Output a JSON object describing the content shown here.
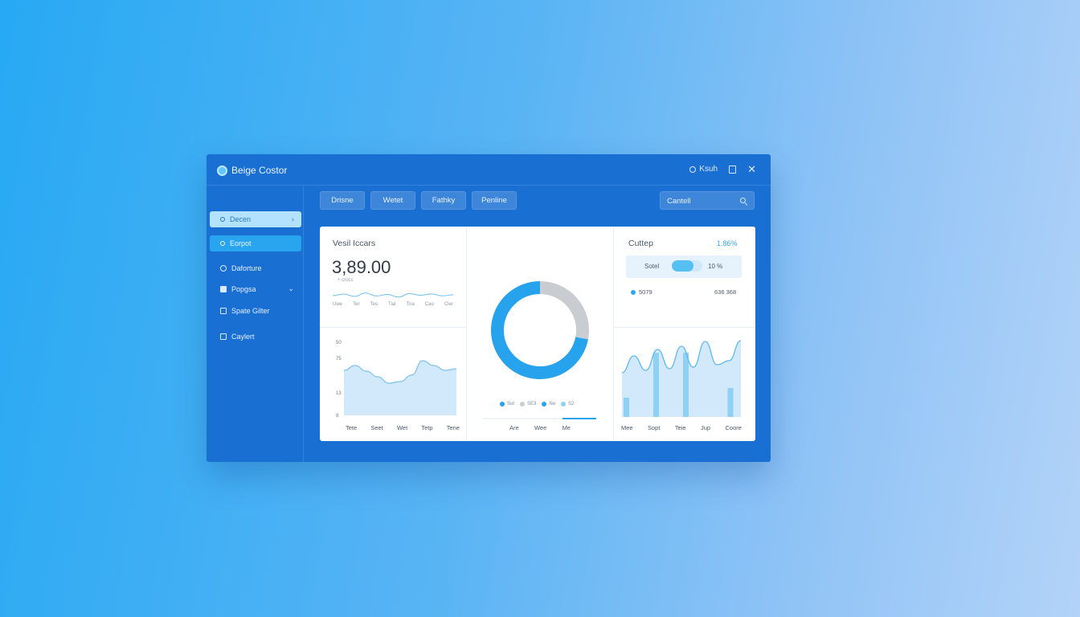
{
  "app": {
    "title": "Beige Costor"
  },
  "titlebar": {
    "action_label": "Ksuh"
  },
  "sidebar": {
    "items": [
      {
        "label": "Decen"
      },
      {
        "label": "Eorpot"
      },
      {
        "label": "Daforture"
      },
      {
        "label": "Popgsa"
      },
      {
        "label": "Spate Gilter"
      },
      {
        "label": "Caylert"
      }
    ]
  },
  "toolbar": {
    "buttons": [
      "Drisne",
      "Wetet",
      "Fathky",
      "Penline"
    ]
  },
  "search": {
    "value": "Cantell"
  },
  "stat": {
    "label": "Vesil Iccars",
    "value": "3,89.00",
    "sub": "+ crocs"
  },
  "sparkline": {
    "ticks": [
      "Uwe",
      "Ter",
      "Tes",
      "Tial",
      "Tira",
      "Cao",
      "Cier"
    ],
    "values": [
      0.42,
      0.5,
      0.38,
      0.55,
      0.4,
      0.48,
      0.34,
      0.52,
      0.44,
      0.5,
      0.41,
      0.46
    ]
  },
  "cup": {
    "title": "Cuttep",
    "pct": "1.86%"
  },
  "progress": {
    "label": "Sotel",
    "pct": "10 %",
    "value": 0.72
  },
  "row": {
    "label": "5079",
    "value": "636 368"
  },
  "colors": {
    "primary": "#27a2ec",
    "light": "#8fd0f5",
    "gray": "#c9cdd2",
    "area": "#d2e9fb"
  },
  "chart_data": [
    {
      "type": "area",
      "ytick_labels": [
        "50",
        "75",
        "13",
        "8"
      ],
      "categories": [
        "Tete",
        "Seet",
        "Wet",
        "Tetp",
        "Tene"
      ],
      "ylim": [
        0,
        100
      ],
      "values": [
        56,
        62,
        55,
        48,
        40,
        42,
        50,
        68,
        62,
        56,
        58
      ]
    },
    {
      "type": "pie",
      "donut": true,
      "values": [
        72,
        28
      ],
      "legend": [
        "Sut",
        "SE3",
        "Ne",
        "S2"
      ],
      "categories": [
        "Are",
        "Wee",
        "Me"
      ]
    },
    {
      "type": "area",
      "categories": [
        "Mee",
        "Sopt",
        "Teie",
        "Jup",
        "Coore"
      ],
      "ylim": [
        0,
        100
      ],
      "values": [
        55,
        76,
        58,
        84,
        60,
        88,
        62,
        94,
        65,
        70,
        95
      ],
      "bar_values": [
        30,
        0,
        100,
        0,
        100,
        0,
        0,
        45
      ]
    }
  ]
}
